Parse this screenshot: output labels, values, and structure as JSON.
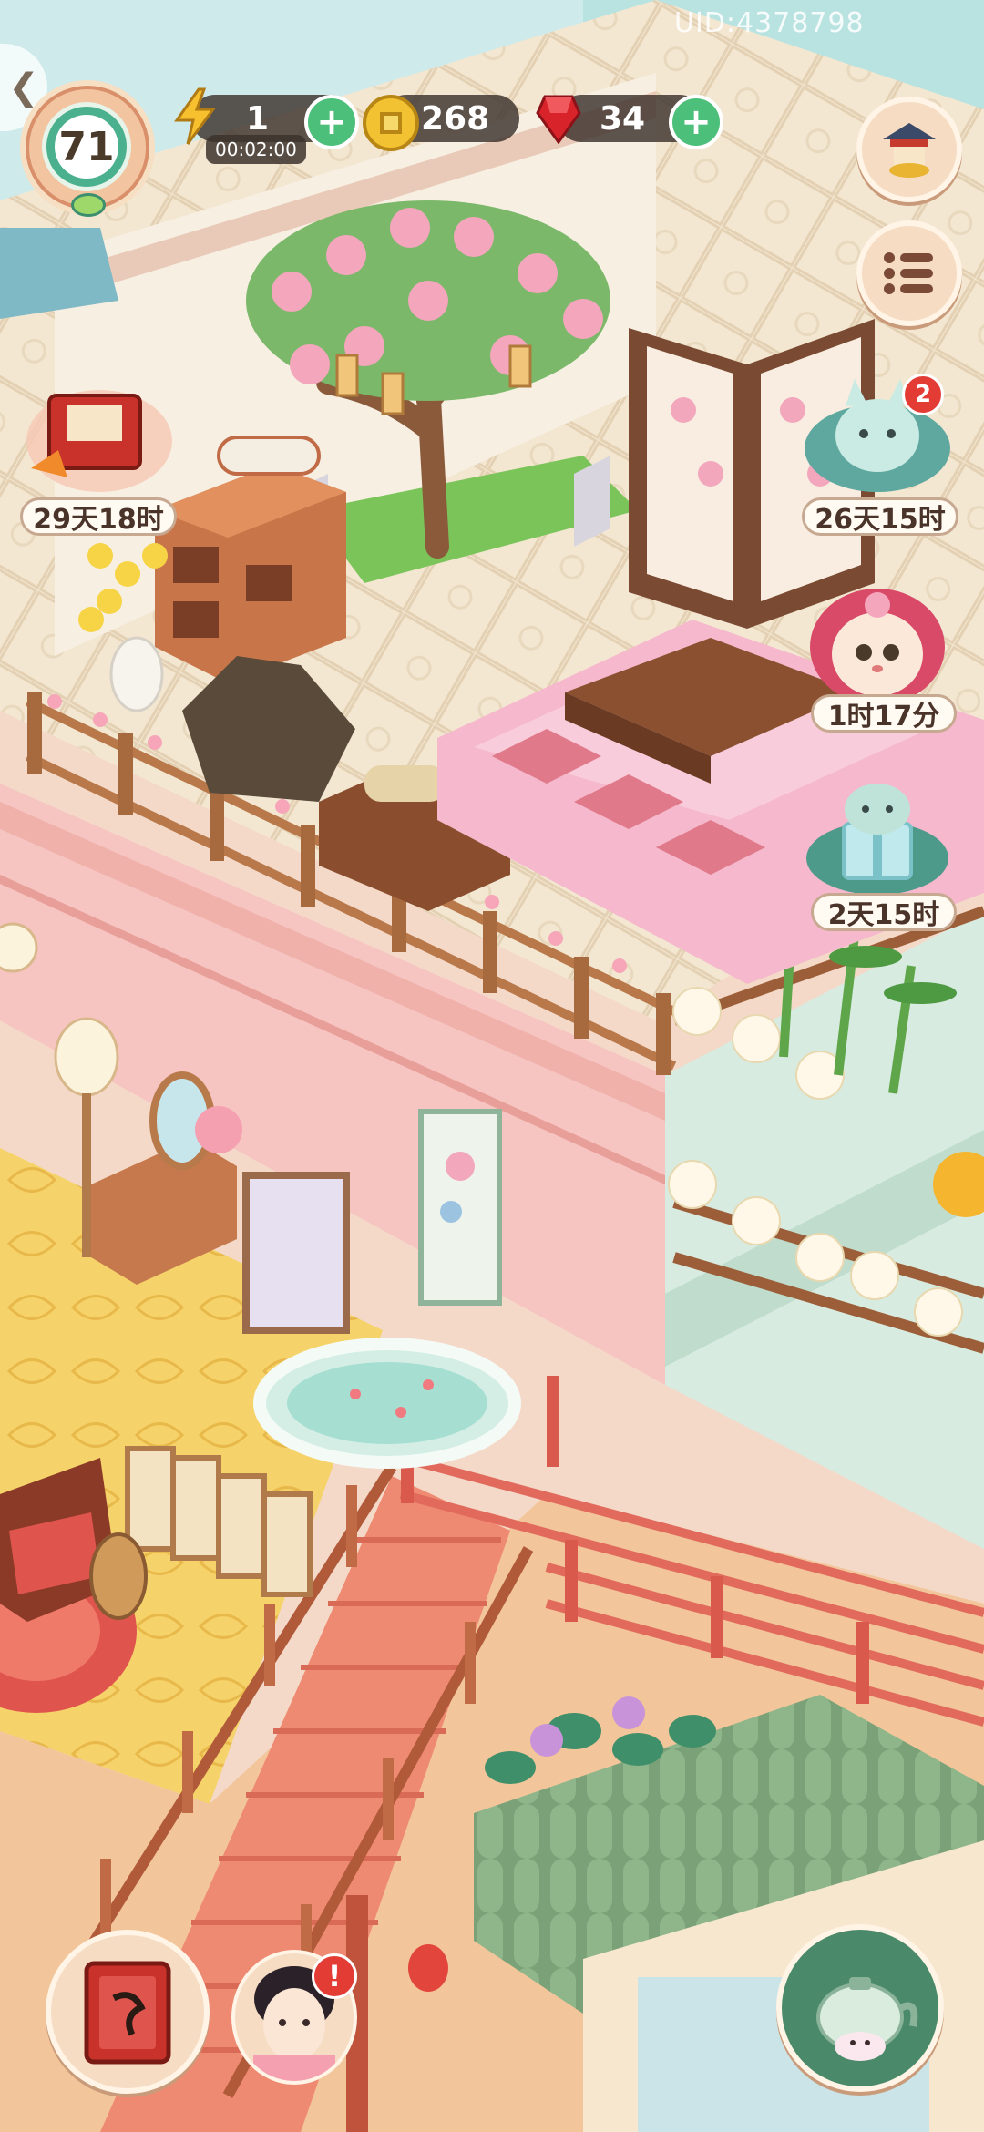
{
  "hud": {
    "uid": "UID:4378798",
    "level": "71",
    "energy": {
      "value": "1",
      "timer": "00:02:00"
    },
    "coins": {
      "value": "268"
    },
    "gems": {
      "value": "34"
    }
  },
  "events": [
    {
      "label": "29天18时",
      "icon": "scroll-book-event-icon"
    },
    {
      "label": "26天15时",
      "icon": "cat-spring-event-icon",
      "badge": "2"
    },
    {
      "label": "1时17分",
      "icon": "cat-hood-event-icon"
    },
    {
      "label": "2天15时",
      "icon": "gift-box-cat-event-icon"
    }
  ],
  "bottom": {
    "journal_icon": "red-book-icon",
    "character_alert": "!",
    "teapot_icon": "teapot-icon"
  },
  "colors": {
    "coin": "#f2c232",
    "gem": "#d8232a",
    "plus_button": "#4cbf7a",
    "badge": "#e33c35"
  }
}
